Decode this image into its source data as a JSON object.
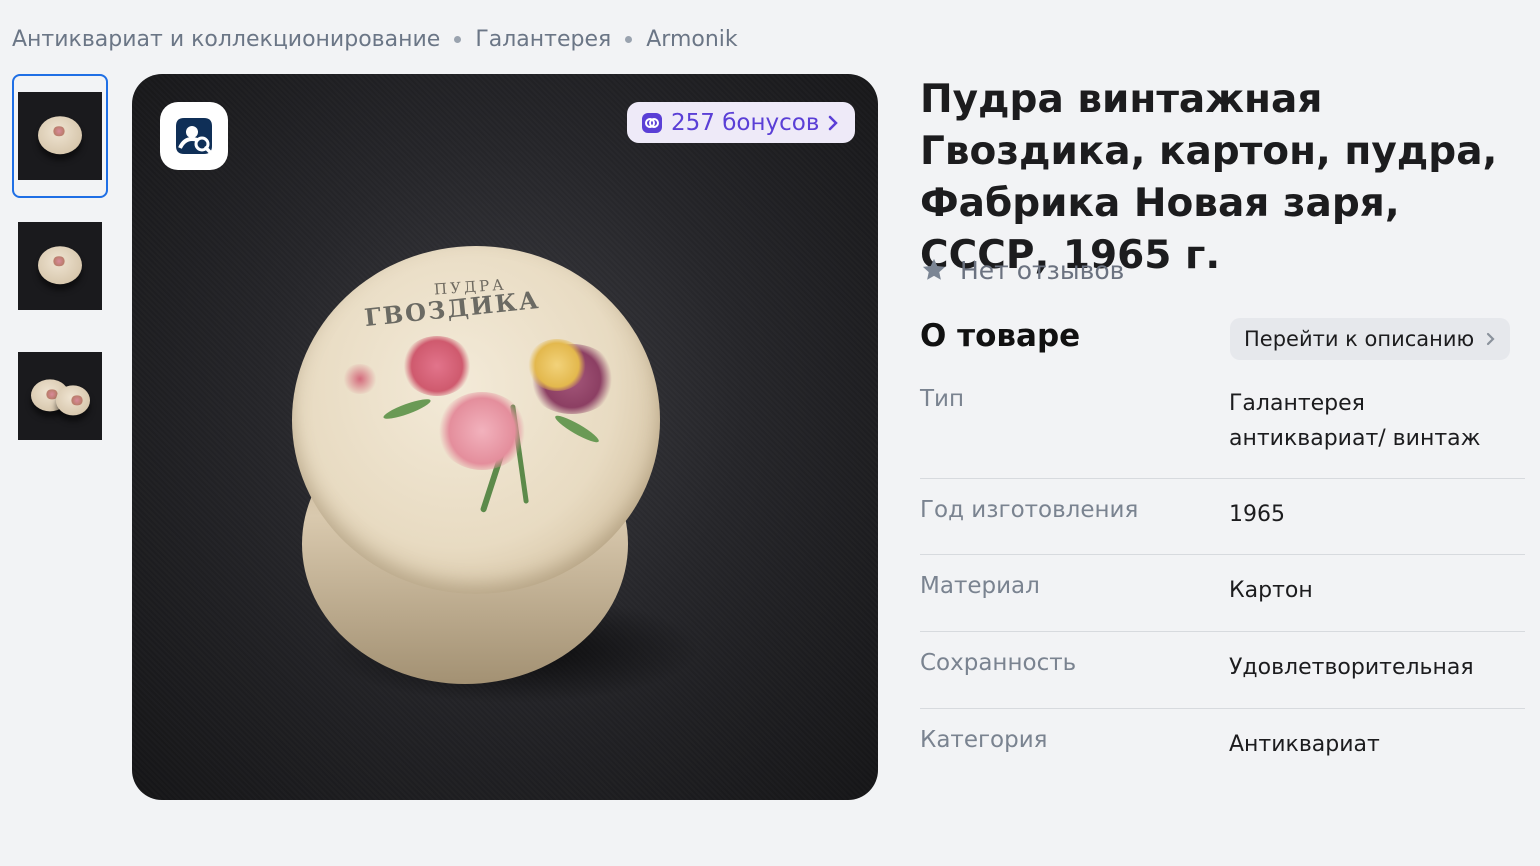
{
  "breadcrumb": {
    "items": [
      "Антиквариат и коллекционирование",
      "Галантерея",
      "Armonik"
    ]
  },
  "gallery": {
    "thumbnails": [
      {
        "icon": "powder-box-top-photo",
        "active": true
      },
      {
        "icon": "powder-box-front-photo",
        "active": false
      },
      {
        "icon": "powder-box-two-photo",
        "active": false
      }
    ],
    "main_image": {
      "lid_text_top": "ПУДРА",
      "lid_text_main": "ГВОЗДИКА"
    },
    "bonus_label": "257 бонусов",
    "lens_icon": "visual-search-icon"
  },
  "product": {
    "title": "Пудра винтажная Гвоздика, картон, пудра, Фабрика Новая заря, СССР, 1965 г.",
    "reviews_label": "Нет отзывов",
    "about_title": "О товаре",
    "goto_description_label": "Перейти к описанию",
    "specs": [
      {
        "key": "Тип",
        "value": "Галантерея антиквариат/ винтаж"
      },
      {
        "key": "Год изготовления",
        "value": "1965"
      },
      {
        "key": "Материал",
        "value": "Картон"
      },
      {
        "key": "Сохранность",
        "value": "Удовлетворительная"
      },
      {
        "key": "Категория",
        "value": "Антиквариат"
      }
    ]
  },
  "colors": {
    "accent_blue": "#1f6fe5",
    "bonus_purple": "#5a3fd6",
    "page_bg": "#f2f3f5"
  }
}
